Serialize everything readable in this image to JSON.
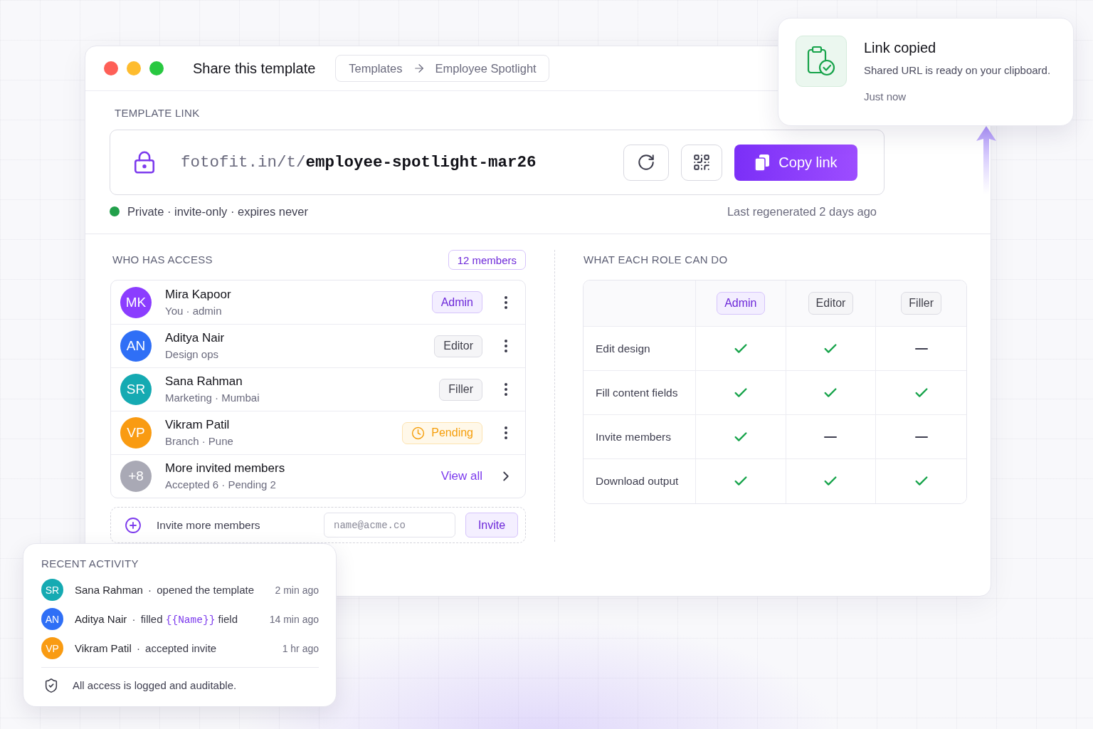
{
  "window": {
    "title": "Share this template",
    "breadcrumb": [
      "Templates",
      "Employee Spotlight"
    ]
  },
  "template_link": {
    "label": "TEMPLATE LINK",
    "url_base": "fotofit.in/t/",
    "url_slug": "employee-spotlight-mar26",
    "copy_button": "Copy link",
    "status": {
      "color": "#22a04b",
      "text": "Private · invite-only · expires never"
    },
    "regenerated": "Last regenerated 2 days ago"
  },
  "access": {
    "title": "WHO HAS ACCESS",
    "count": "12 members",
    "members": [
      {
        "kind": "member",
        "initials": "MK",
        "color": "#8b3dff",
        "name": "Mira Kapoor",
        "detail": "You · admin",
        "role": {
          "kind": "admin",
          "label": "Admin"
        }
      },
      {
        "kind": "member",
        "initials": "AN",
        "color": "#2f6ff6",
        "name": "Aditya Nair",
        "detail": "Design ops",
        "role": {
          "kind": "editor",
          "label": "Editor"
        }
      },
      {
        "kind": "member",
        "initials": "SR",
        "color": "#15aab2",
        "name": "Sana Rahman",
        "detail": "Marketing · Mumbai",
        "role": {
          "kind": "filler",
          "label": "Filler"
        }
      },
      {
        "kind": "member",
        "initials": "VP",
        "color": "#f99b12",
        "name": "Vikram Patil",
        "detail": "Branch · Pune",
        "role": {
          "kind": "pending",
          "label": "Pending"
        }
      },
      {
        "kind": "summary",
        "initials": "+8",
        "color": "#a9a9b5",
        "name": "More invited members",
        "detail": "Accepted 6 · Pending 2",
        "link": "View all"
      }
    ],
    "invite": {
      "label": "Invite more members",
      "placeholder": "name@acme.co",
      "button": "Invite"
    }
  },
  "permissions": {
    "title": "WHAT EACH ROLE CAN DO",
    "columns": [
      {
        "label": "Admin",
        "highlighted": true
      },
      {
        "label": "Editor",
        "highlighted": false
      },
      {
        "label": "Filler",
        "highlighted": false
      }
    ],
    "rows": [
      {
        "label": "Edit design",
        "allowed": [
          true,
          true,
          false
        ]
      },
      {
        "label": "Fill content fields",
        "allowed": [
          true,
          true,
          true
        ]
      },
      {
        "label": "Invite members",
        "allowed": [
          true,
          false,
          false
        ]
      },
      {
        "label": "Download output",
        "allowed": [
          true,
          true,
          true
        ]
      }
    ]
  },
  "toast": {
    "title": "Link copied",
    "message": "Shared URL is ready on your clipboard.",
    "time": "Just now"
  },
  "recent_activity": {
    "title": "RECENT ACTIVITY",
    "items": [
      {
        "initials": "SR",
        "color": "#15aab2",
        "actor": "Sana Rahman",
        "separator": "·",
        "action": [
          {
            "kind": "text",
            "text": "opened the template"
          }
        ],
        "time": "2 min ago"
      },
      {
        "initials": "AN",
        "color": "#2f6ff6",
        "actor": "Aditya Nair",
        "separator": "·",
        "action": [
          {
            "kind": "text",
            "text": "filled"
          },
          {
            "kind": "token",
            "text": "{{Name}}"
          },
          {
            "kind": "text",
            "text": "field"
          }
        ],
        "time": "14 min ago"
      },
      {
        "initials": "VP",
        "color": "#f99b12",
        "actor": "Vikram Patil",
        "separator": "·",
        "action": [
          {
            "kind": "text",
            "text": "accepted invite"
          }
        ],
        "time": "1 hr ago"
      }
    ],
    "footer": "All access is logged and auditable."
  }
}
